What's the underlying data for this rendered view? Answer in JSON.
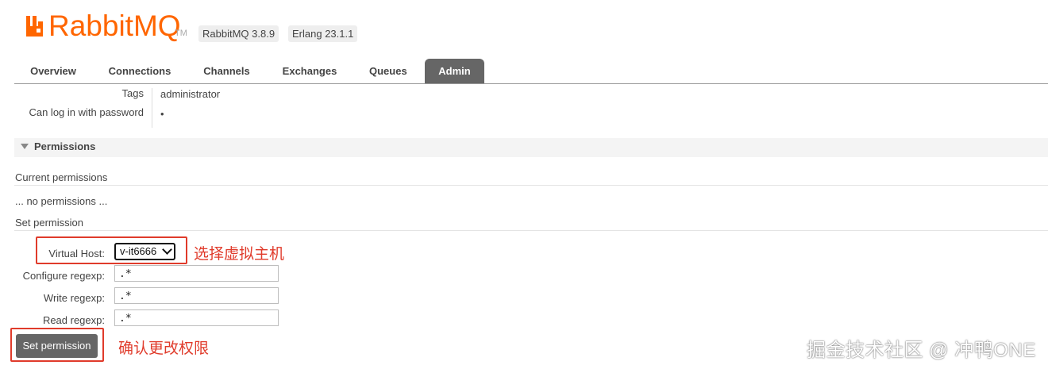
{
  "header": {
    "logo_text": "RabbitMQ",
    "logo_tm": "TM",
    "version_badge": "RabbitMQ 3.8.9",
    "erlang_badge": "Erlang 23.1.1"
  },
  "tabs": [
    {
      "label": "Overview"
    },
    {
      "label": "Connections"
    },
    {
      "label": "Channels"
    },
    {
      "label": "Exchanges"
    },
    {
      "label": "Queues"
    },
    {
      "label": "Admin"
    }
  ],
  "user_info": {
    "tags_label": "Tags",
    "tags_value": "administrator",
    "password_label": "Can log in with password",
    "password_value": "•"
  },
  "permissions": {
    "section_title": "Permissions",
    "current_heading": "Current permissions",
    "current_empty": "... no permissions ...",
    "set_heading": "Set permission",
    "virtual_host_label": "Virtual Host:",
    "virtual_host_value": "v-it6666",
    "configure_label": "Configure regexp:",
    "configure_value": ".*",
    "write_label": "Write regexp:",
    "write_value": ".*",
    "read_label": "Read regexp:",
    "read_value": ".*",
    "submit_label": "Set permission"
  },
  "annotations": {
    "select_vhost": "选择虚拟主机",
    "confirm_change": "确认更改权限",
    "color": "#e03b2b"
  },
  "watermark": "掘金技术社区 @ 冲鸭ONE",
  "colors": {
    "brand": "#ff6600",
    "active_tab": "#666666",
    "button": "#666666"
  }
}
